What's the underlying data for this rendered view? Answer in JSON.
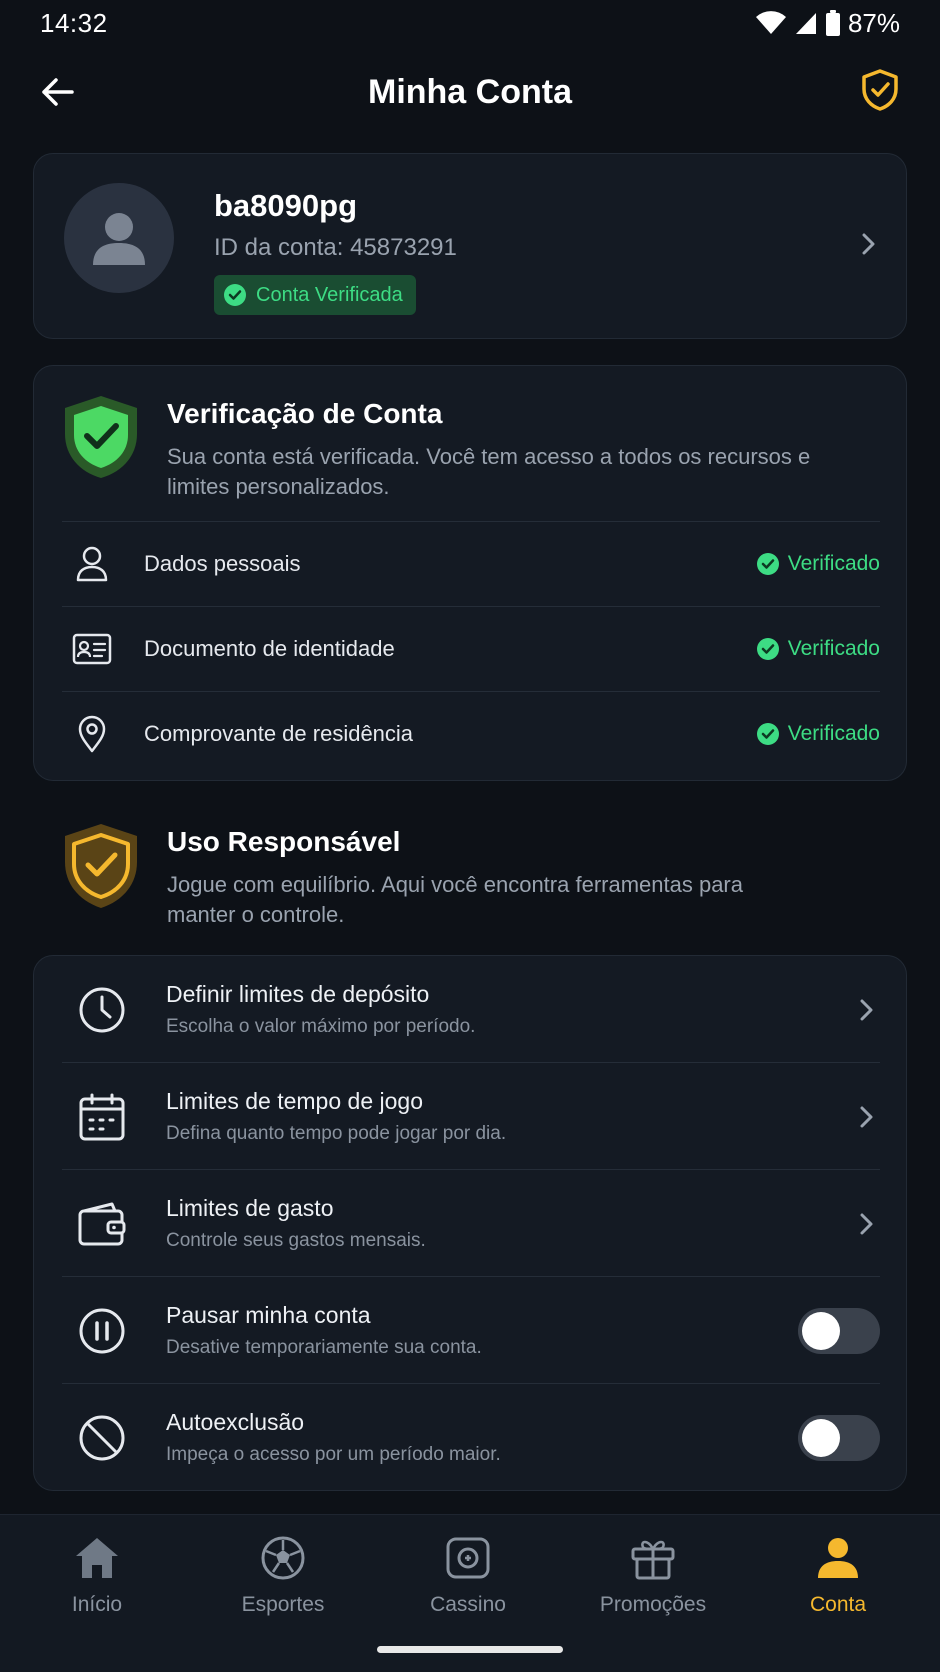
{
  "status_bar": {
    "time": "14:32",
    "battery": "87%"
  },
  "header": {
    "title": "Minha Conta"
  },
  "profile": {
    "username": "ba8090pg",
    "account_id": "ID da conta: 45873291",
    "badge": "Conta Verificada"
  },
  "verification": {
    "title": "Verificação de Conta",
    "description": "Sua conta está verificada. Você tem acesso a todos os recursos e limites personalizados.",
    "items": [
      {
        "label": "Dados pessoais",
        "status": "Verificado",
        "icon": "person-icon"
      },
      {
        "label": "Documento de identidade",
        "status": "Verificado",
        "icon": "id-card-icon"
      },
      {
        "label": "Comprovante de residência",
        "status": "Verificado",
        "icon": "location-pin-icon"
      }
    ]
  },
  "responsible": {
    "title": "Uso Responsável",
    "description": "Jogue com equilíbrio. Aqui você encontra ferramentas para manter o controle.",
    "tools": [
      {
        "title": "Definir limites de depósito",
        "subtitle": "Escolha o valor máximo por período.",
        "control": "chevron",
        "icon": "clock-icon"
      },
      {
        "title": "Limites de tempo de jogo",
        "subtitle": "Defina quanto tempo pode jogar por dia.",
        "control": "chevron",
        "icon": "calendar-icon"
      },
      {
        "title": "Limites de gasto",
        "subtitle": "Controle seus gastos mensais.",
        "control": "chevron",
        "icon": "wallet-icon"
      },
      {
        "title": "Pausar minha conta",
        "subtitle": "Desative temporariamente sua conta.",
        "control": "toggle",
        "toggle_on": false,
        "icon": "pause-icon"
      },
      {
        "title": "Autoexclusão",
        "subtitle": "Impeça o acesso por um período maior.",
        "control": "toggle",
        "toggle_on": false,
        "icon": "block-icon"
      }
    ]
  },
  "nav": {
    "items": [
      {
        "label": "Início",
        "icon": "home-icon"
      },
      {
        "label": "Esportes",
        "icon": "soccer-ball-icon"
      },
      {
        "label": "Cassino",
        "icon": "casino-chip-icon"
      },
      {
        "label": "Promoções",
        "icon": "gift-icon"
      },
      {
        "label": "Conta",
        "icon": "user-icon",
        "active": true
      }
    ]
  },
  "colors": {
    "background": "#0d1117",
    "card": "#141a23",
    "accent": "#f5b82e",
    "success": "#3ddc84",
    "muted": "#9aa3af"
  }
}
